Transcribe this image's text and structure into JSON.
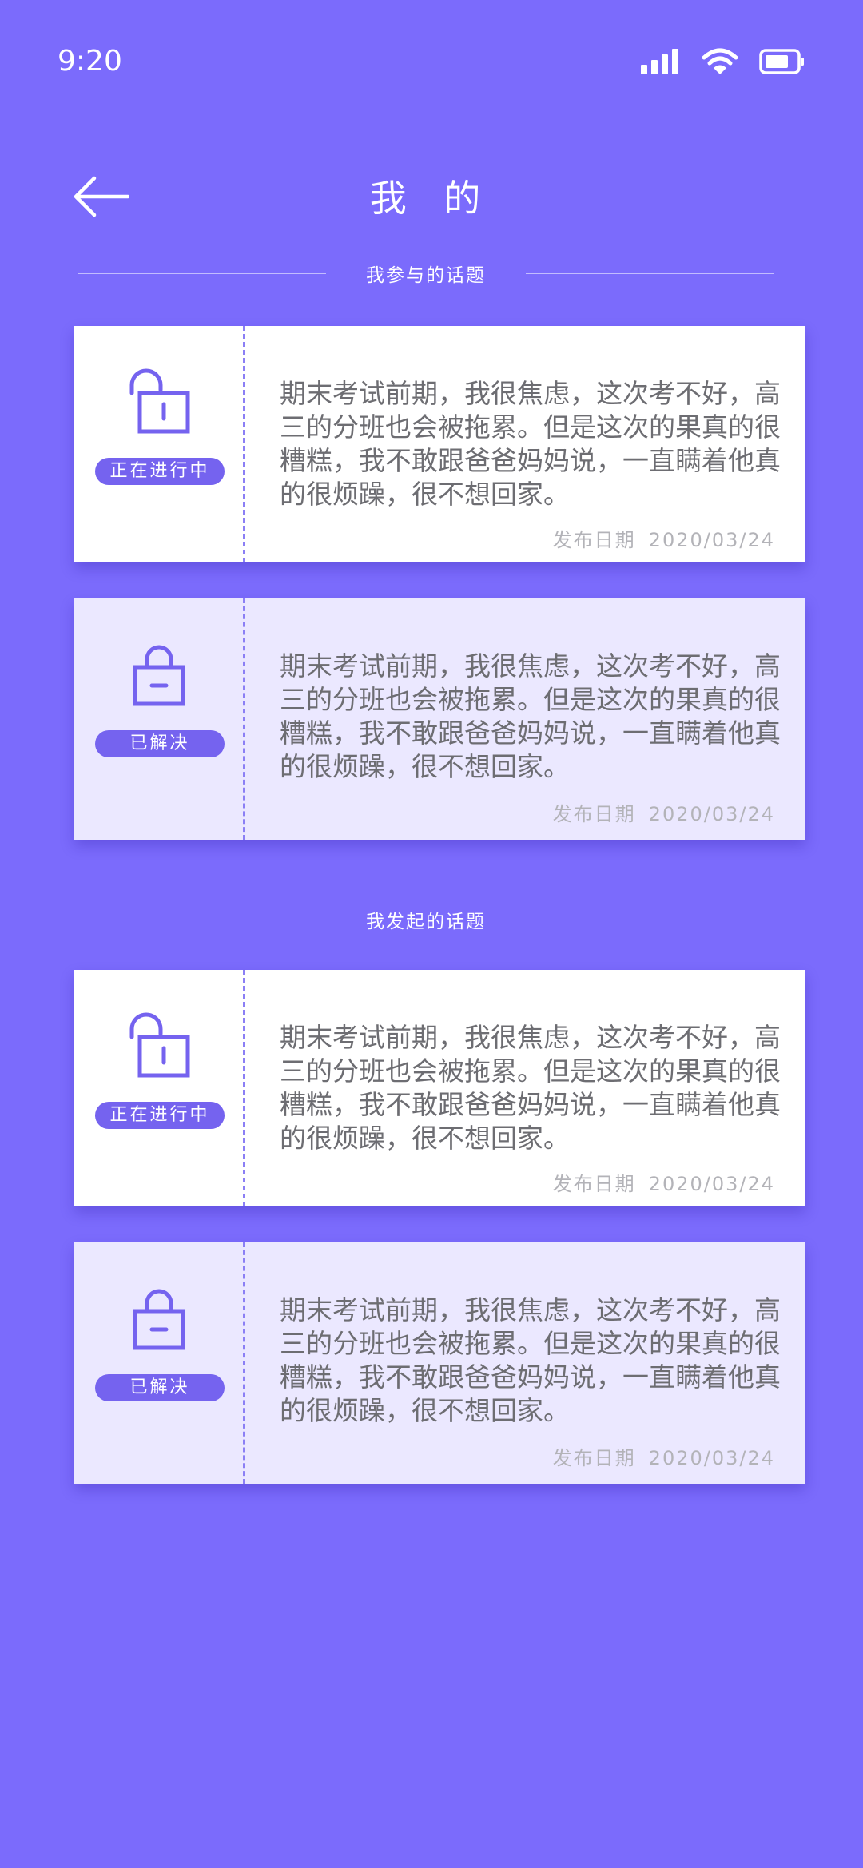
{
  "status_bar": {
    "time": "9:20",
    "icons": [
      "signal-icon",
      "wifi-icon",
      "battery-icon"
    ]
  },
  "header": {
    "title": "我 的",
    "back_icon": "arrow-left-icon"
  },
  "sections": [
    {
      "title": "我参与的话题",
      "cards": [
        {
          "status": "正在进行中",
          "state": "active",
          "icon": "lock-open-icon",
          "text": "期末考试前期，我很焦虑，这次考不好，高三的分班也会被拖累。但是这次的果真的很糟糕，我不敢跟爸爸妈妈说，一直瞒着他真的很烦躁，很不想回家。",
          "date_label": "发布日期",
          "date": "2020/03/24"
        },
        {
          "status": "已解决",
          "state": "solved",
          "icon": "lock-closed-icon",
          "text": "期末考试前期，我很焦虑，这次考不好，高三的分班也会被拖累。但是这次的果真的很糟糕，我不敢跟爸爸妈妈说，一直瞒着他真的很烦躁，很不想回家。",
          "date_label": "发布日期",
          "date": "2020/03/24"
        }
      ]
    },
    {
      "title": "我发起的话题",
      "cards": [
        {
          "status": "正在进行中",
          "state": "active",
          "icon": "lock-open-icon",
          "text": "期末考试前期，我很焦虑，这次考不好，高三的分班也会被拖累。但是这次的果真的很糟糕，我不敢跟爸爸妈妈说，一直瞒着他真的很烦躁，很不想回家。",
          "date_label": "发布日期",
          "date": "2020/03/24"
        },
        {
          "status": "已解决",
          "state": "solved",
          "icon": "lock-closed-icon",
          "text": "期末考试前期，我很焦虑，这次考不好，高三的分班也会被拖累。但是这次的果真的很糟糕，我不敢跟爸爸妈妈说，一直瞒着他真的很烦躁，很不想回家。",
          "date_label": "发布日期",
          "date": "2020/03/24"
        }
      ]
    }
  ],
  "colors": {
    "background": "#7b6bfc",
    "accent": "#7563ef",
    "card_active": "#ffffff",
    "card_solved": "#ebe8ff",
    "body_text": "#6d6d72",
    "date_text": "#b3b3b8"
  }
}
